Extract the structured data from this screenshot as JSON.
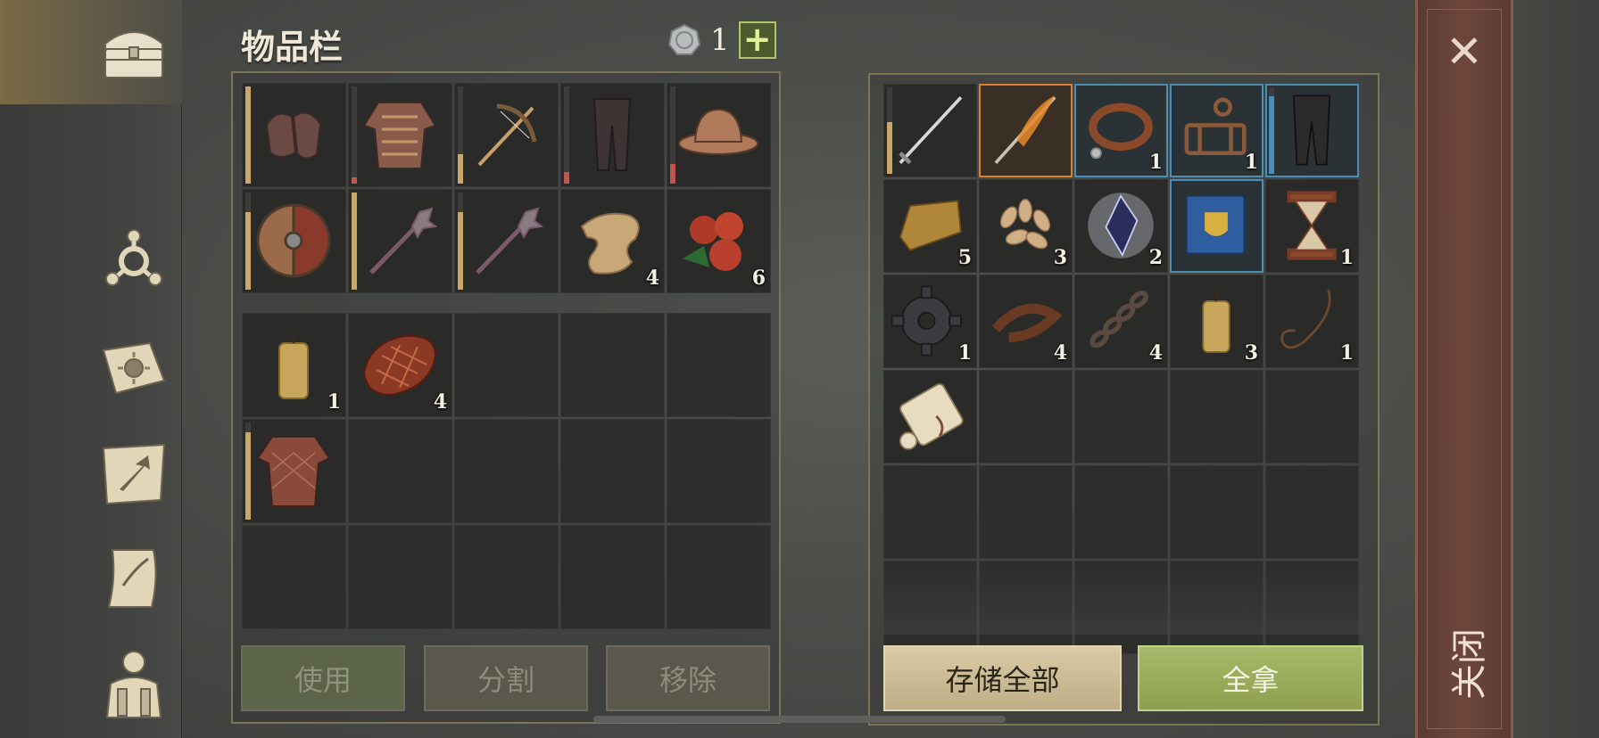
{
  "inventory": {
    "title": "物品栏",
    "currency": {
      "icon": "silver-coin-icon",
      "count": "1",
      "add_label": "+"
    }
  },
  "sidebar": {
    "items": [
      {
        "name": "chest-icon"
      },
      {
        "name": "skills-icon"
      },
      {
        "name": "recipes-book-icon"
      },
      {
        "name": "map-icon"
      },
      {
        "name": "quests-scroll-icon"
      },
      {
        "name": "character-icon"
      }
    ]
  },
  "left_grid_top": [
    {
      "item": "chainmail-gloves",
      "durability": 1.0,
      "dur_color": "#c9a86a"
    },
    {
      "item": "chainmail-shirt",
      "durability": 0.06,
      "dur_color": "#c0564f"
    },
    {
      "item": "crossbow",
      "durability": 0.3,
      "dur_color": "#c9a86a"
    },
    {
      "item": "chainmail-leggings",
      "durability": 0.12,
      "dur_color": "#c0564f"
    },
    {
      "item": "kettle-helmet",
      "durability": 0.2,
      "dur_color": "#c0564f"
    },
    {
      "item": "round-shield",
      "durability": 0.8,
      "dur_color": "#c9a86a"
    },
    {
      "item": "mace",
      "durability": 1.0,
      "dur_color": "#c9a86a"
    },
    {
      "item": "mace",
      "durability": 0.8,
      "dur_color": "#c9a86a"
    },
    {
      "item": "cloth-bandage",
      "qty": "4"
    },
    {
      "item": "berries",
      "qty": "6"
    }
  ],
  "left_grid_bottom": [
    {
      "item": "candle",
      "qty": "1"
    },
    {
      "item": "meat",
      "qty": "4"
    },
    {},
    {},
    {},
    {
      "item": "gambeson",
      "durability": 0.9,
      "dur_color": "#c9a86a"
    },
    {},
    {},
    {},
    {},
    {},
    {},
    {},
    {},
    {}
  ],
  "right_grid": [
    {
      "item": "sword",
      "durability": 0.6,
      "dur_color": "#c9a86a"
    },
    {
      "item": "flaming-sword",
      "rarity": "epic"
    },
    {
      "item": "leather-collar",
      "qty": "1",
      "rarity": "rare"
    },
    {
      "item": "mechanism-trap",
      "qty": "1",
      "rarity": "rare"
    },
    {
      "item": "dark-leggings",
      "rarity": "rare",
      "durability": 0.9,
      "dur_color": "#4a8db5"
    },
    {
      "item": "gold-ingot",
      "qty": "5"
    },
    {
      "item": "seeds",
      "qty": "3"
    },
    {
      "item": "crystal-shard",
      "qty": "2"
    },
    {
      "item": "blue-book",
      "rarity": "rare"
    },
    {
      "item": "hourglass",
      "qty": "1"
    },
    {
      "item": "gear",
      "qty": "1"
    },
    {
      "item": "leather-strap",
      "qty": "4"
    },
    {
      "item": "chain",
      "qty": "4"
    },
    {
      "item": "candle",
      "qty": "3"
    },
    {
      "item": "rope",
      "qty": "1"
    },
    {
      "item": "scroll"
    },
    {},
    {},
    {},
    {},
    {},
    {},
    {},
    {},
    {},
    {},
    {},
    {},
    {},
    {}
  ],
  "buttons": {
    "use": "使用",
    "split": "分割",
    "remove": "移除",
    "store_all": "存储全部",
    "take_all": "全拿"
  },
  "close": {
    "icon": "close-icon",
    "label": "关闭"
  }
}
